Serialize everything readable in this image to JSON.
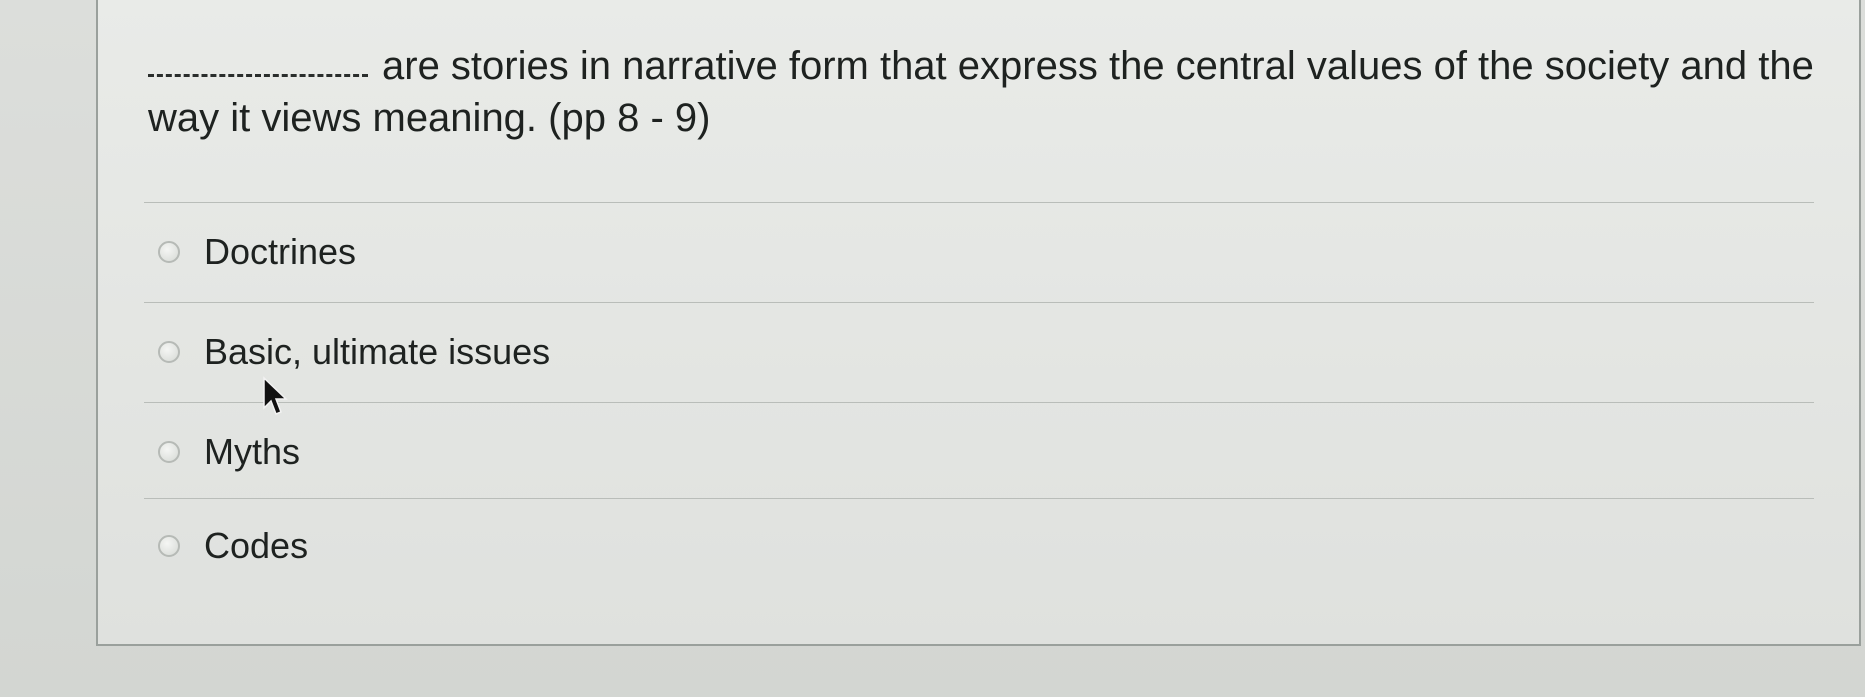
{
  "question": {
    "blank": "___________",
    "text": "are stories in narrative form that express the central values of the society and the way it views meaning. (pp 8 - 9)"
  },
  "answers": [
    {
      "label": "Doctrines",
      "selected": false
    },
    {
      "label": "Basic, ultimate issues",
      "selected": false
    },
    {
      "label": "Myths",
      "selected": false
    },
    {
      "label": "Codes",
      "selected": false
    }
  ],
  "cursor": {
    "icon": "arrow-pointer-icon"
  }
}
